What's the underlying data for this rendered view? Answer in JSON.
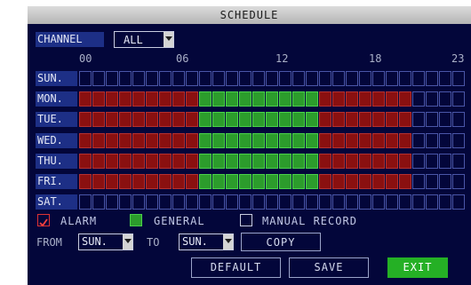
{
  "title": "SCHEDULE",
  "channel": {
    "label": "CHANNEL",
    "value": "ALL"
  },
  "hours": [
    "00",
    "06",
    "12",
    "18",
    "23"
  ],
  "days": [
    {
      "label": "SUN.",
      "cells": "nnnnnnnnnnnnnnnnnnnnnnnn"
    },
    {
      "label": "MON.",
      "cells": "aaaaaaaaagggggggggaaaaaaa"
    },
    {
      "label": "TUE.",
      "cells": "aaaaaaaaagggggggggaaaaaaa"
    },
    {
      "label": "WED.",
      "cells": "aaaaaaaaagggggggggaaaaaaa"
    },
    {
      "label": "THU.",
      "cells": "aaaaaaaaagggggggggaaaaaaa"
    },
    {
      "label": "FRI.",
      "cells": "aaaaaaaaagggggggggaaaaaaa"
    },
    {
      "label": "SAT.",
      "cells": "nnnnnnnnnnnnnnnnnnnnnnnn"
    }
  ],
  "legend": {
    "alarm": "ALARM",
    "general": "GENERAL",
    "manual": "MANUAL RECORD"
  },
  "copy_row": {
    "from_label": "FROM",
    "from_value": "SUN.",
    "to_label": "TO",
    "to_value": "SUN.",
    "copy_button": "COPY"
  },
  "buttons": {
    "default": "DEFAULT",
    "save": "SAVE",
    "exit": "EXIT"
  },
  "colors": {
    "background": "#03063a",
    "alarm": "#8a1010",
    "general": "#2c9c2c",
    "label_bg": "#1d2f86",
    "exit": "#25b025"
  }
}
